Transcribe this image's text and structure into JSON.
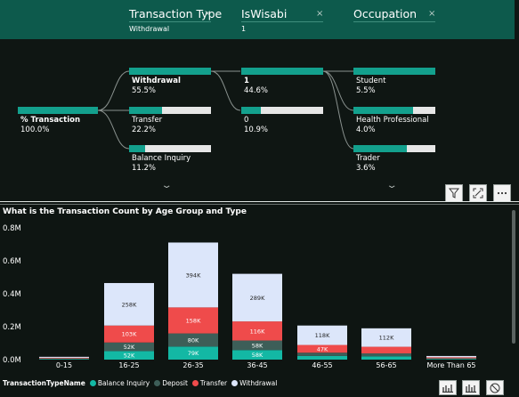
{
  "decomposition": {
    "header": [
      {
        "title": "Transaction Type",
        "filter": "Withdrawal"
      },
      {
        "title": "IsWisabi",
        "filter": "1"
      },
      {
        "title": "Occupation",
        "filter": ""
      }
    ],
    "close_glyph": "×",
    "root": {
      "label": "% Transaction",
      "value": "100.0%",
      "fraction": 1.0
    },
    "level1": [
      {
        "label": "Withdrawal",
        "value": "55.5%",
        "fraction": 1.0,
        "selected": true
      },
      {
        "label": "Transfer",
        "value": "22.2%",
        "fraction": 0.4,
        "selected": false
      },
      {
        "label": "Balance Inquiry",
        "value": "11.2%",
        "fraction": 0.2,
        "selected": false
      }
    ],
    "level2": [
      {
        "label": "1",
        "value": "44.6%",
        "fraction": 1.0,
        "selected": true
      },
      {
        "label": "0",
        "value": "10.9%",
        "fraction": 0.24,
        "selected": false
      }
    ],
    "level3": [
      {
        "label": "Student",
        "value": "5.5%",
        "fraction": 1.0,
        "selected": false
      },
      {
        "label": "Health Professional",
        "value": "4.0%",
        "fraction": 0.73,
        "selected": false
      },
      {
        "label": "Trader",
        "value": "3.6%",
        "fraction": 0.65,
        "selected": false
      }
    ],
    "expand_icon": "chevron-down-icon",
    "toolbar_icons": [
      "filter-icon",
      "focus-mode-icon",
      "more-options-icon"
    ]
  },
  "chart_data": {
    "type": "bar",
    "stacked": true,
    "title": "What is the Transaction Count by Age Group and Type",
    "categories": [
      "0-15",
      "16-25",
      "26-35",
      "36-45",
      "46-55",
      "56-65",
      "More Than 65"
    ],
    "ytick_labels": [
      "0.0M",
      "0.2M",
      "0.4M",
      "0.6M",
      "0.8M"
    ],
    "ylim": [
      0,
      800000
    ],
    "series": [
      {
        "name": "Balance Inquiry",
        "color": "#13b8a4",
        "values": [
          4000,
          52000,
          79000,
          58000,
          22000,
          20000,
          4000
        ],
        "labels": [
          "",
          "52K",
          "79K",
          "58K",
          "",
          "",
          ""
        ]
      },
      {
        "name": "Deposit",
        "color": "#3d5e58",
        "values": [
          3000,
          52000,
          80000,
          58000,
          20000,
          18000,
          4000
        ],
        "labels": [
          "",
          "52K",
          "80K",
          "58K",
          "",
          "",
          ""
        ]
      },
      {
        "name": "Transfer",
        "color": "#ef4b4b",
        "values": [
          4000,
          103000,
          158000,
          116000,
          47000,
          40000,
          6000
        ],
        "labels": [
          "",
          "103K",
          "158K",
          "116K",
          "47K",
          "",
          ""
        ]
      },
      {
        "name": "Withdrawal",
        "color": "#dce6fa",
        "values": [
          6000,
          258000,
          394000,
          289000,
          118000,
          112000,
          8000
        ],
        "labels": [
          "",
          "258K",
          "394K",
          "289K",
          "118K",
          "112K",
          ""
        ]
      }
    ],
    "legend_title": "TransactionTypeName",
    "legend_position": "bottom-left",
    "grid": false
  },
  "chart_toolbar_icons": [
    "drill-down-icon",
    "expand-hierarchy-icon",
    "disable-icon"
  ]
}
